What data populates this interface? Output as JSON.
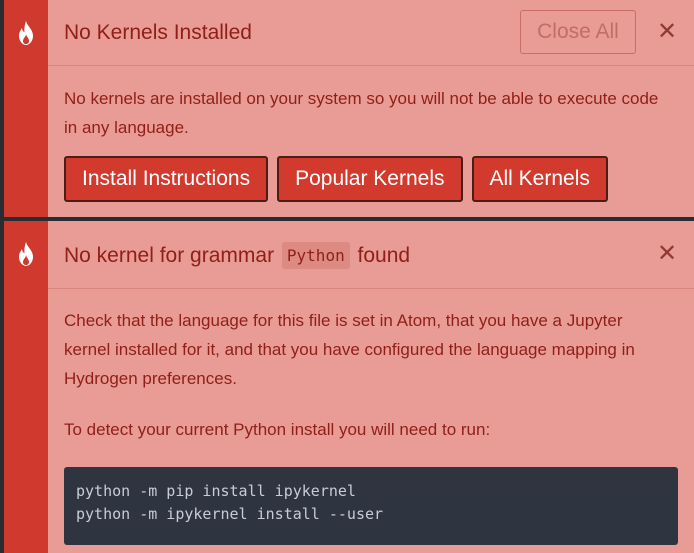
{
  "colors": {
    "panel_bg": "#e89c95",
    "stripe": "#d0392d",
    "text": "#8f1f17",
    "button_bg": "#d23a2e",
    "code_bg": "#2f3441"
  },
  "icons": {
    "notification_icon": "flame-icon",
    "dismiss_icon": "close-icon"
  },
  "notification1": {
    "title": "No Kernels Installed",
    "close_all_label": "Close All",
    "dismiss_glyph": "✕",
    "message": "No kernels are installed on your system so you will not be able to execute code in any language.",
    "buttons": [
      "Install Instructions",
      "Popular Kernels",
      "All Kernels"
    ]
  },
  "notification2": {
    "title_before": "No kernel for grammar",
    "grammar": "Python",
    "title_after": "found",
    "dismiss_glyph": "✕",
    "message": "Check that the language for this file is set in Atom, that you have a Jupyter kernel installed for it, and that you have configured the language mapping in Hydrogen preferences.",
    "detect_text": "To detect your current Python install you will need to run:",
    "code_lines": [
      "python -m pip install ipykernel",
      "python -m ipykernel install --user"
    ]
  }
}
